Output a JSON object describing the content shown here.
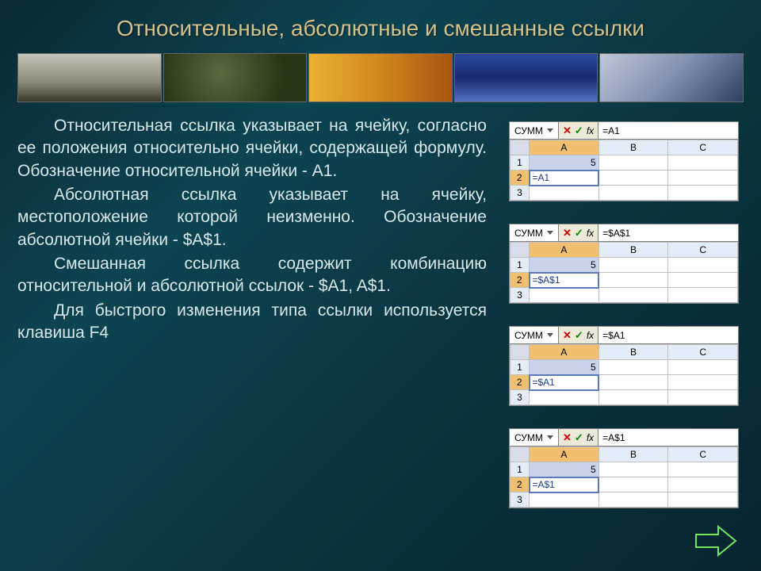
{
  "title": "Относительные, абсолютные и смешанные ссылки",
  "paragraphs": [
    "Относительная ссылка указывает на ячейку, согласно ее положения относительно ячейки, содержащей формулу. Обозначение относительной ячейки - A1.",
    "Абсолютная ссылка указывает на ячейку, местоположение которой неизменно. Обозначение абсолютной ячейки - $A$1.",
    "Смешанная ссылка содержит комбинацию относительной и абсолютной ссылок - $A1, A$1.",
    "Для быстрого изменения типа ссылки используется клавиша F4"
  ],
  "fxbar": {
    "name_label": "СУММ",
    "btn_x": "✕",
    "btn_v": "✓",
    "btn_fx": "fx"
  },
  "columns": [
    "A",
    "B",
    "C"
  ],
  "rows": [
    "1",
    "2",
    "3"
  ],
  "sheets": [
    {
      "formula_bar": "=A1",
      "a1": "5",
      "a2_edit": "=A1"
    },
    {
      "formula_bar": "=$A$1",
      "a1": "5",
      "a2_edit": "=$A$1"
    },
    {
      "formula_bar": "=$A1",
      "a1": "5",
      "a2_edit": "=$A1"
    },
    {
      "formula_bar": "=A$1",
      "a1": "5",
      "a2_edit": "=A$1"
    }
  ]
}
